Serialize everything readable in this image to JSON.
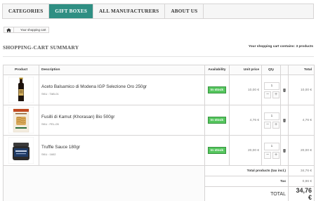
{
  "nav": {
    "items": [
      {
        "label": "CATEGORIES"
      },
      {
        "label": "GIFT BOXES"
      },
      {
        "label": "ALL MANUFACTURERS"
      },
      {
        "label": "ABOUT US"
      }
    ],
    "active": "GIFT BOXES",
    "active_color": "#2f8f83"
  },
  "breadcrumb": {
    "home_icon": "home-icon",
    "current": "Your shopping cart"
  },
  "summary": {
    "title": "SHOPPING-CART SUMMARY",
    "count_text": "Your shopping cart contains: 3 products"
  },
  "table": {
    "headers": {
      "product": "Product",
      "description": "Description",
      "availability": "Availability",
      "unit_price": "Unit price",
      "qty": "Qty",
      "total": "Total"
    },
    "items": [
      {
        "name": "Aceto Balsamico di Modena IGP Selezione Oro 250gr",
        "sku": "SKU : TAB-01",
        "availability": "In stock",
        "unit_price": "10,00 €",
        "qty": "1",
        "total": "10,00 €",
        "image": "vinegar-bottle"
      },
      {
        "name": "Fusilli di Kamut (Khorasan) Bio 500gr",
        "sku": "SKU : FEL-05",
        "availability": "In stock",
        "unit_price": "4,76 €",
        "qty": "1",
        "total": "4,76 €",
        "image": "pasta-bag"
      },
      {
        "name": "Truffle Sauce 180gr",
        "sku": "SKU : 1602",
        "availability": "In stock",
        "unit_price": "20,00 €",
        "qty": "1",
        "total": "20,00 €",
        "image": "sauce-jar"
      }
    ],
    "totals": {
      "products_label": "Total products (tax incl.)",
      "products_value": "34,76 €",
      "tax_label": "Tax",
      "tax_value": "0,86 €",
      "grand_label": "TOTAL",
      "grand_value": "34,76 €"
    },
    "stock_color": "#55c65e"
  }
}
